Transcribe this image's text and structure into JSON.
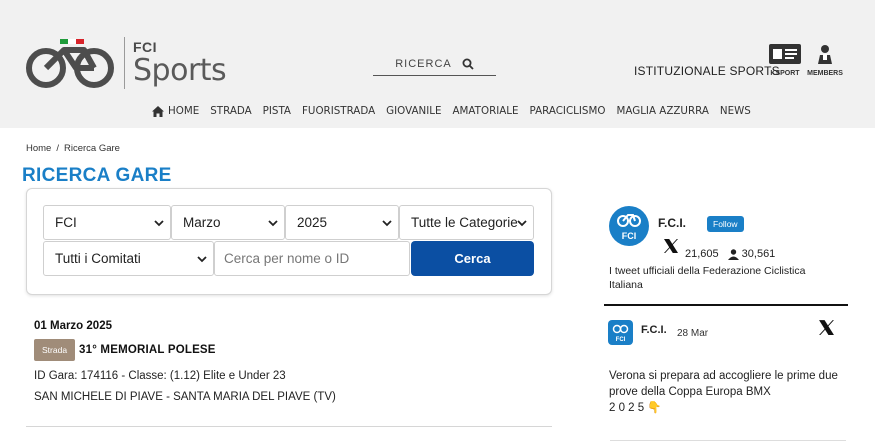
{
  "header": {
    "logo": {
      "brand": "FCI",
      "name": "Sports"
    },
    "search_label": "RICERCA",
    "istituzionale": "ISTITUZIONALE SPORTS",
    "ksport_label": "KSPORT",
    "members_label": "MEMBERS",
    "nav": [
      "HOME",
      "STRADA",
      "PISTA",
      "FUORISTRADA",
      "GIOVANILE",
      "AMATORIALE",
      "PARACICLISMO",
      "MAGLIA AZZURRA",
      "NEWS"
    ]
  },
  "breadcrumb": {
    "home": "Home",
    "sep": "/",
    "current": "Ricerca Gare"
  },
  "page_title": "RICERCA GARE",
  "filters": {
    "federazione": "FCI",
    "mese": "Marzo",
    "anno": "2025",
    "categoria": "Tutte le Categorie",
    "comitato": "Tutti i Comitati",
    "search_placeholder": "Cerca per nome o ID",
    "submit_label": "Cerca"
  },
  "race": {
    "date": "01 Marzo 2025",
    "badge": "Strada",
    "name": "31° MEMORIAL POLESE",
    "meta": "ID Gara: 174116 - Classe: (1.12) Elite e Under 23",
    "location": "SAN MICHELE DI PIAVE - SANTA MARIA DEL PIAVE (TV)"
  },
  "twitter": {
    "avatar_text": "FCI",
    "name": "F.C.I.",
    "follow_label": "Follow",
    "followers": "21,605",
    "following": "30,561",
    "description": "I tweet ufficiali della Federazione Ciclistica Italiana",
    "tweet": {
      "name": "F.C.I.",
      "date": "28 Mar",
      "text": "Verona si prepara ad accogliere le prime due prove della Coppa Europa BMX",
      "text_tail": "2 0 2 5 👇"
    }
  },
  "colors": {
    "accent": "#1a7fc7",
    "button": "#0b4fa3",
    "badge": "#a08c79",
    "header_bg": "#f1f1f1"
  },
  "icons": [
    "bike-logo-icon",
    "search-icon",
    "ksport-card-icon",
    "members-icon",
    "home-icon",
    "chevron-down-icon",
    "x-logo-icon",
    "user-icon"
  ]
}
